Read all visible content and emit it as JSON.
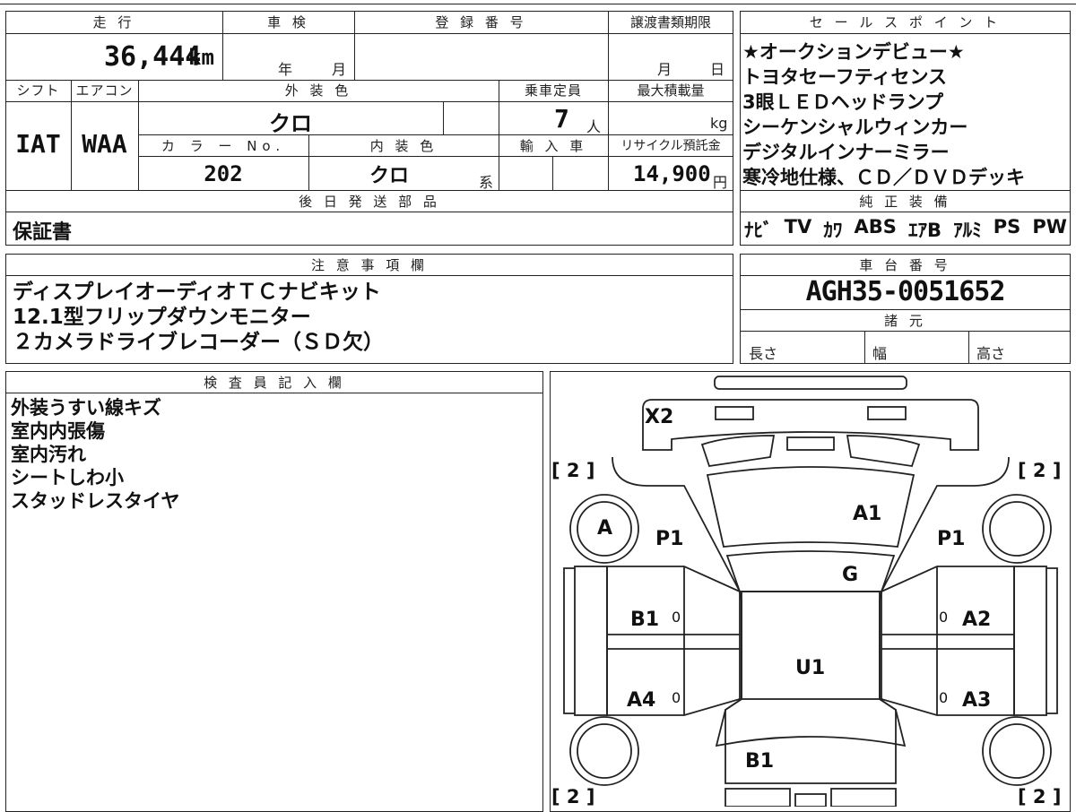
{
  "mileage": {
    "header": "走 行",
    "value": "36,444",
    "unit": "km"
  },
  "inspection": {
    "header": "車 検",
    "year_label": "年",
    "month_label": "月"
  },
  "registration": {
    "header": "登 録 番 号",
    "value": ""
  },
  "transfer_deadline": {
    "header": "譲渡書類期限",
    "month_label": "月",
    "day_label": "日"
  },
  "shift": {
    "header": "シフト",
    "value": "IAT"
  },
  "aircon": {
    "header": "エアコン",
    "value": "WAA"
  },
  "exterior_color": {
    "header": "外 装 色",
    "value": "クロ"
  },
  "capacity": {
    "header": "乗車定員",
    "value": "7",
    "unit": "人"
  },
  "max_load": {
    "header": "最大積載量",
    "unit": "kg"
  },
  "color_no": {
    "header": "カ ラ ー No.",
    "value": "202"
  },
  "interior_color": {
    "header": "内 装 色",
    "value": "クロ",
    "suffix": "系"
  },
  "import": {
    "header": "輸 入 車"
  },
  "recycle_fee": {
    "header": "リサイクル預託金",
    "value": "14,900",
    "unit": "円"
  },
  "later_parts": {
    "header": "後 日 発 送 部 品",
    "value": "保証書"
  },
  "sales_points": {
    "header": "セ ー ル ス ポ イ ン ト",
    "items": [
      "★オークションデビュー★",
      "トヨタセーフティセンス",
      "3眼ＬＥＤヘッドランプ",
      "シーケンシャルウィンカー",
      "デジタルインナーミラー",
      "寒冷地仕様、ＣＤ／ＤＶＤデッキ"
    ]
  },
  "genuine_equipment": {
    "header": "純 正 装 備",
    "items": [
      "ﾅﾋﾞ",
      "TV",
      "ｶﾜ",
      "ABS",
      "ｴｱB",
      "ｱﾙﾐ",
      "PS",
      "PW"
    ]
  },
  "notes": {
    "header": "注 意 事 項 欄",
    "lines": [
      "ディスプレイオーディオＴＣナビキット",
      "12.1型フリップダウンモニター",
      "２カメラドライブレコーダー（ＳＤ欠）"
    ]
  },
  "chassis_number": {
    "header": "車 台 番 号",
    "value": "AGH35-0051652"
  },
  "specs": {
    "header": "諸 元",
    "length_label": "長さ",
    "width_label": "幅",
    "height_label": "高さ"
  },
  "inspector": {
    "header": "検 査 員 記 入 欄",
    "lines": [
      "外装うすい線キズ",
      "室内内張傷",
      "室内汚れ",
      "シートしわ小",
      "スタッドレスタイヤ"
    ]
  },
  "diagram": {
    "labels": {
      "x2": "X2",
      "a1": "A1",
      "a": "A",
      "p1_left": "P1",
      "p1_right": "P1",
      "g": "G",
      "b1_left": "B1",
      "a2": "A2",
      "u1": "U1",
      "a4": "A4",
      "a3": "A3",
      "b1_rear": "B1",
      "tire_fl": "[ 2 ]",
      "tire_fr": "[ 2 ]",
      "tire_rl": "[ 2 ]",
      "tire_rr": "[ 2 ]",
      "zero": "0"
    }
  }
}
